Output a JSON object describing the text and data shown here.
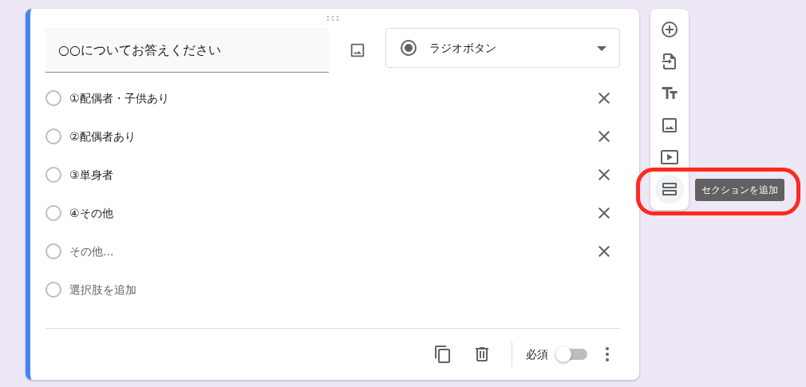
{
  "question": {
    "title": "○○についてお答えください",
    "type_label": "ラジオボタン"
  },
  "options": [
    {
      "kind": "option",
      "label": "①配偶者・子供あり"
    },
    {
      "kind": "option",
      "label": "②配偶者あり"
    },
    {
      "kind": "option",
      "label": "③単身者"
    },
    {
      "kind": "option",
      "label": "④その他"
    },
    {
      "kind": "other",
      "label": "その他..."
    },
    {
      "kind": "add",
      "label": "選択肢を追加"
    }
  ],
  "footer": {
    "required_label": "必須",
    "required_on": false
  },
  "toolbar": {
    "items": [
      {
        "kind": "add_question",
        "hovered": false
      },
      {
        "kind": "import",
        "hovered": false
      },
      {
        "kind": "title",
        "hovered": false
      },
      {
        "kind": "image",
        "hovered": false
      },
      {
        "kind": "video",
        "hovered": false
      },
      {
        "kind": "section",
        "hovered": true
      }
    ],
    "tooltip": "セクションを追加"
  }
}
